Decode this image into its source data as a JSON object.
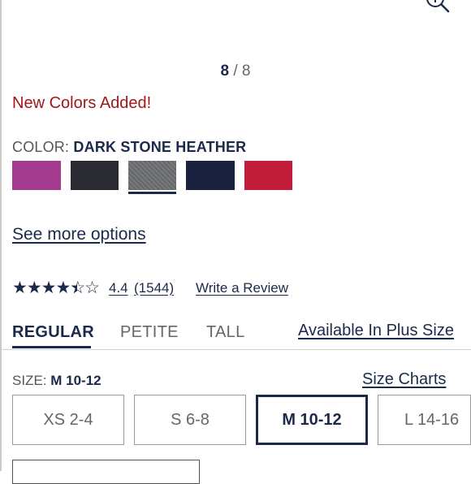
{
  "gallery": {
    "current": "8",
    "separator": "/",
    "total": "8"
  },
  "promo": "New Colors Added!",
  "color": {
    "label": "COLOR:",
    "selected": "DARK STONE HEATHER",
    "swatches": [
      {
        "color": "#a33b8f",
        "selected": false
      },
      {
        "color": "#2a2b30",
        "selected": false
      },
      {
        "color": "#6d6f72",
        "selected": true
      },
      {
        "color": "#1a2240",
        "selected": false
      },
      {
        "color": "#c21d3a",
        "selected": false
      }
    ]
  },
  "see_more": "See more options",
  "rating": {
    "stars": "★★★★",
    "partial_star": "★",
    "empty_star": "☆",
    "value": "4.4",
    "count": "(1544)",
    "write_review": "Write a Review"
  },
  "fit_tabs": [
    {
      "label": "REGULAR",
      "active": true
    },
    {
      "label": "PETITE",
      "active": false
    },
    {
      "label": "TALL",
      "active": false
    }
  ],
  "plus_size_link": "Available In Plus Size",
  "size": {
    "label": "SIZE:",
    "selected": "M 10-12",
    "charts_link": "Size Charts",
    "options": [
      {
        "label": "XS 2-4",
        "selected": false
      },
      {
        "label": "S 6-8",
        "selected": false
      },
      {
        "label": "M 10-12",
        "selected": true
      },
      {
        "label": "L 14-16",
        "selected": false
      }
    ]
  },
  "colors": {
    "navy": "#1b2a4a",
    "sale_red": "#a4161a",
    "muted": "#666666"
  }
}
